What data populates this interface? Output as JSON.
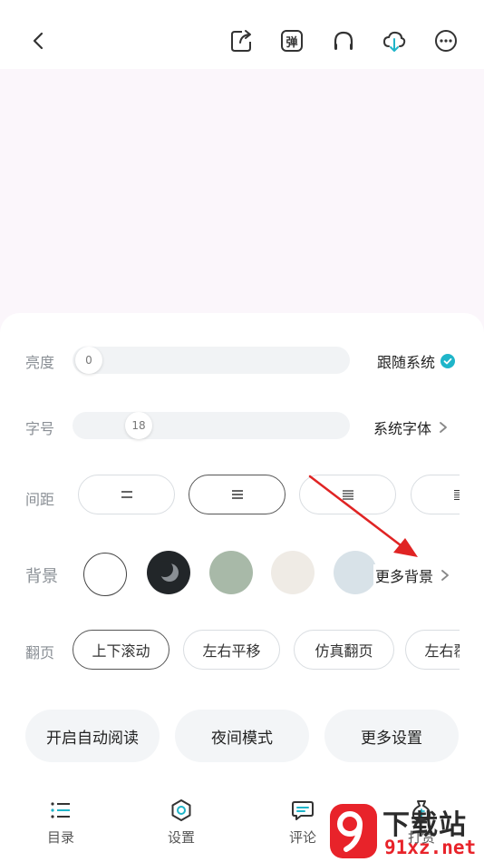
{
  "topbar": {
    "icons": [
      "back-icon",
      "share-icon",
      "danmaku-icon",
      "headphones-icon",
      "cloud-download-icon",
      "more-icon"
    ],
    "danmaku_label": "弹"
  },
  "brightness": {
    "label": "亮度",
    "value": "0",
    "value_fraction": 0,
    "follow_system": "跟随系统",
    "follow_checked": true
  },
  "font_size": {
    "label": "字号",
    "value": "18",
    "value_fraction": 0.22,
    "font_family": "系统字体"
  },
  "spacing": {
    "label": "间距",
    "options": [
      "=",
      "≡",
      "≣",
      "≣"
    ],
    "selected_index": 1
  },
  "background": {
    "label": "背景",
    "swatches": [
      "#ffffff",
      "#222629",
      "#a8b9a8",
      "#efebe5",
      "#d8e2e8"
    ],
    "selected_index": 0,
    "more": "更多背景"
  },
  "page_turn": {
    "label": "翻页",
    "options": [
      "上下滚动",
      "左右平移",
      "仿真翻页",
      "左右覆盖"
    ],
    "selected_index": 0
  },
  "actions": {
    "auto_read": "开启自动阅读",
    "night_mode": "夜间模式",
    "more_settings": "更多设置"
  },
  "bottom_nav": {
    "toc": "目录",
    "settings": "设置",
    "comments": "评论",
    "gift": "打赏"
  },
  "colors": {
    "accent": "#1fb5c9",
    "arrow": "#e02424",
    "watermark_red": "#e8232a",
    "watermark_dark": "#2b2b2b"
  },
  "watermark": {
    "brand": "下载站",
    "domain": "91xz.net",
    "logo": "9"
  }
}
